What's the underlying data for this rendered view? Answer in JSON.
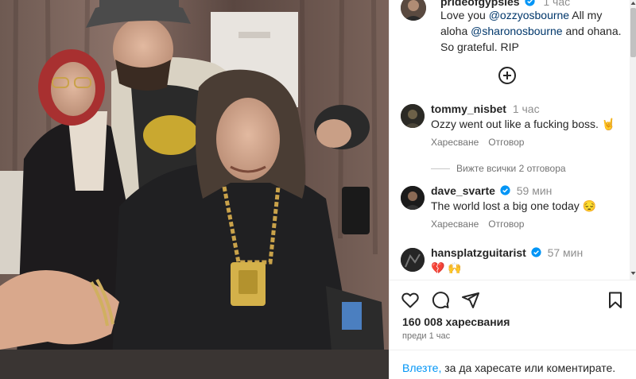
{
  "post": {
    "photo_icon": "post-photo-group-of-people",
    "caption": {
      "username": "prideofgypsies",
      "time": "1 час",
      "text_before": "Love you ",
      "mention1": "@ozzyosbourne",
      "text_middle": "  All my aloha ",
      "mention2": "@sharonosbourne",
      "text_after": " and ohana.  So grateful. RIP"
    },
    "comments": [
      {
        "username": "tommy_nisbet",
        "time": "1 час",
        "text": "Ozzy went out like a fucking boss. 🤘",
        "like_label": "Харесване",
        "reply_label": "Отговор",
        "verified": false
      },
      {
        "username": "dave_svarte",
        "time": "59 мин",
        "text": "The world lost a big one today 😔",
        "like_label": "Харесване",
        "reply_label": "Отговор",
        "verified": true
      },
      {
        "username": "hansplatzguitarist",
        "time": "57 мин",
        "text": "💔 🙌",
        "verified": true
      }
    ],
    "view_replies": "Вижте всички 2 отговора",
    "likes": "160 008 харесвания",
    "posted_ago": "преди 1 час",
    "login_link": "Влезте,",
    "login_rest": " за да харесате или коментирате."
  },
  "colors": {
    "verified": "#0095f6",
    "link": "#0095f6",
    "mention": "#00376b",
    "muted": "#737373"
  }
}
